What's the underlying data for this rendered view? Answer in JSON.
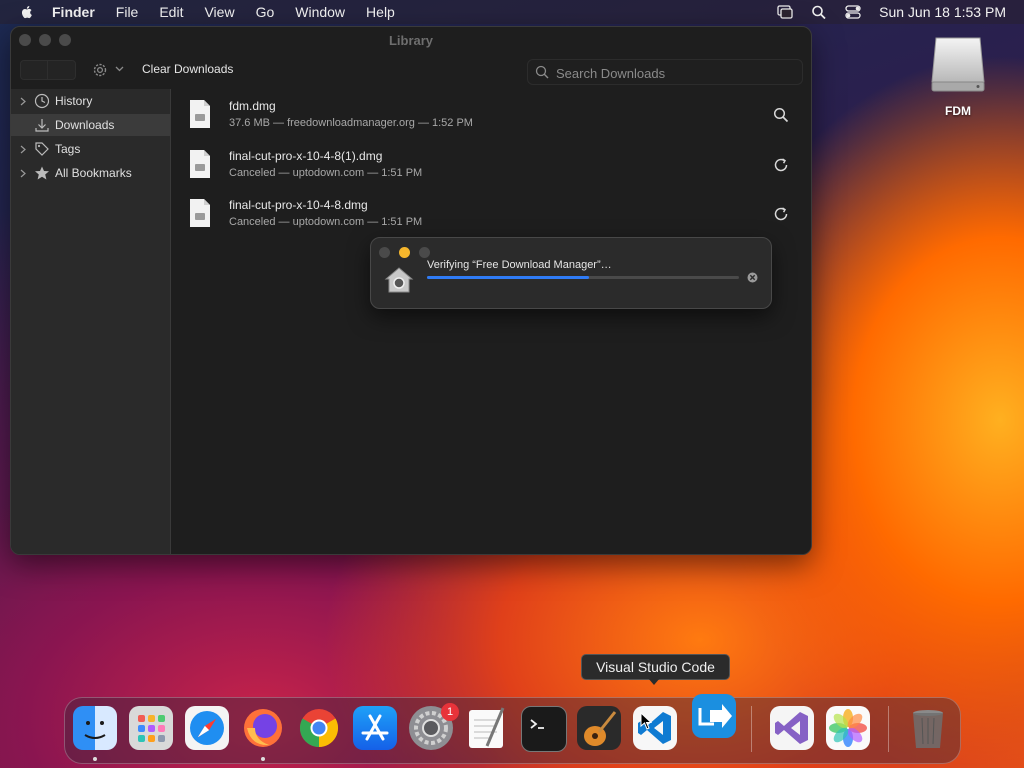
{
  "menubar": {
    "items": [
      "Finder",
      "File",
      "Edit",
      "View",
      "Go",
      "Window",
      "Help"
    ],
    "clock": "Sun Jun 18  1:53 PM",
    "icons": [
      "apple-icon",
      "screen-mirroring-icon",
      "spotlight-icon",
      "control-center-icon"
    ]
  },
  "window": {
    "title": "Library",
    "toolbar": {
      "clear_label": "Clear Downloads",
      "search_placeholder": "Search Downloads"
    },
    "sidebar": {
      "items": [
        {
          "label": "History",
          "icon": "clock-icon"
        },
        {
          "label": "Downloads",
          "icon": "download-icon"
        },
        {
          "label": "Tags",
          "icon": "tag-icon"
        },
        {
          "label": "All Bookmarks",
          "icon": "star-icon"
        }
      ]
    },
    "downloads": [
      {
        "name": "fdm.dmg",
        "meta": "37.6 MB — freedownloadmanager.org — 1:52 PM",
        "action": "magnifier-icon"
      },
      {
        "name": "final-cut-pro-x-10-4-8(1).dmg",
        "meta": "Canceled — uptodown.com — 1:51 PM",
        "action": "retry-icon"
      },
      {
        "name": "final-cut-pro-x-10-4-8.dmg",
        "meta": "Canceled — uptodown.com — 1:51 PM",
        "action": "retry-icon"
      }
    ]
  },
  "dialog": {
    "message": "Verifying “Free Download Manager”…",
    "progress": 0.52
  },
  "desktop": {
    "drive_label": "FDM"
  },
  "dock": {
    "tooltip": "Visual Studio Code",
    "badge_count": "1",
    "apps": [
      "Finder",
      "Launchpad",
      "Safari",
      "Firefox",
      "Chrome",
      "App Store",
      "System Preferences",
      "TextEdit",
      "Terminal",
      "GarageBand",
      "Visual Studio Code",
      "FDM",
      "Visual Studio",
      "Photos",
      "Trash"
    ]
  },
  "colors": {
    "accent": "#2f7bf5",
    "badge": "#e8333a",
    "window_bg": "#1e1e1e",
    "sidebar_bg": "#2a2a2a"
  }
}
